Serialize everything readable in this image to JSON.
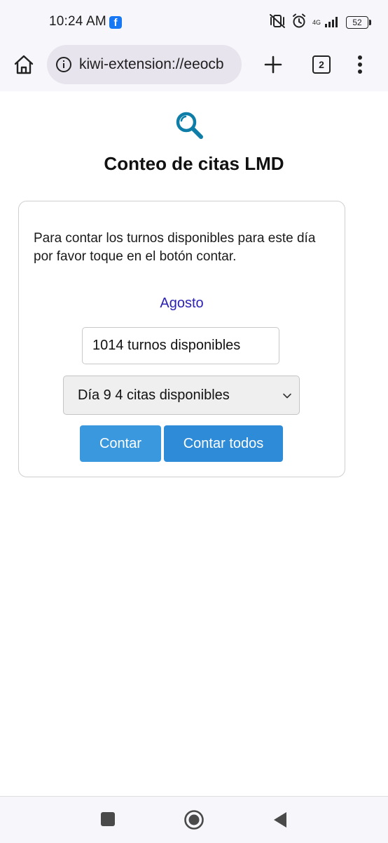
{
  "status_bar": {
    "time": "10:24 AM",
    "network": "4G",
    "battery": "52"
  },
  "browser": {
    "url": "kiwi-extension://eeocb",
    "tab_count": "2"
  },
  "icons": {
    "status": [
      "facebook-icon",
      "muted-vibrate-icon",
      "alarm-icon",
      "signal-icon",
      "battery-icon"
    ],
    "toolbar": [
      "home-icon",
      "info-icon",
      "plus-icon",
      "tabs-icon",
      "more-vert-icon"
    ],
    "page": [
      "search-icon",
      "chevron-down-icon"
    ],
    "nav": [
      "recents-icon",
      "home-circle-icon",
      "back-icon"
    ]
  },
  "page": {
    "title": "Conteo de citas LMD",
    "description": "Para contar los turnos disponibles para este día por favor toque en el botón contar.",
    "month": "Agosto",
    "count_value": "1014 turnos disponibles",
    "day_select": "Día 9 4 citas disponibles",
    "buttons": {
      "count": "Contar",
      "count_all": "Contar todos"
    }
  },
  "colors": {
    "accent_logo": "#0e7ea8",
    "month_link": "#2b22b5",
    "button_primary": "#3a98de",
    "button_secondary": "#2d8bd8"
  }
}
